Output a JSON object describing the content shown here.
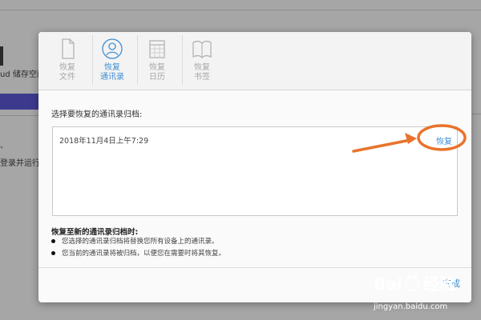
{
  "background": {
    "storage_text": "ud 储存空间",
    "mark_text": "、",
    "login_text": "登录并运行 i"
  },
  "tabs": [
    {
      "icon": "document-icon",
      "label_line1": "恢复",
      "label_line2": "文件",
      "active": false
    },
    {
      "icon": "contact-icon",
      "label_line1": "恢复",
      "label_line2": "通讯录",
      "active": true
    },
    {
      "icon": "calendar-icon",
      "label_line1": "恢复",
      "label_line2": "日历",
      "active": false
    },
    {
      "icon": "book-icon",
      "label_line1": "恢复",
      "label_line2": "书签",
      "active": false
    }
  ],
  "main": {
    "prompt": "选择要恢复的通讯录归档:",
    "archives": [
      {
        "date": "2018年11月4日上午7:29",
        "action": "恢复"
      }
    ]
  },
  "notes": {
    "title": "恢复至新的通讯录归档时:",
    "items": [
      "您选择的通讯录归档将替换您所有设备上的通讯录。",
      "您当前的通讯录将被归档，以便您在需要时将其恢复。"
    ]
  },
  "footer": {
    "done_label": "完成"
  },
  "annotation": {
    "color": "#e8742c"
  },
  "watermark": {
    "brand": "Bai",
    "brand2": "经验",
    "url": "jingyan.baidu.com"
  }
}
